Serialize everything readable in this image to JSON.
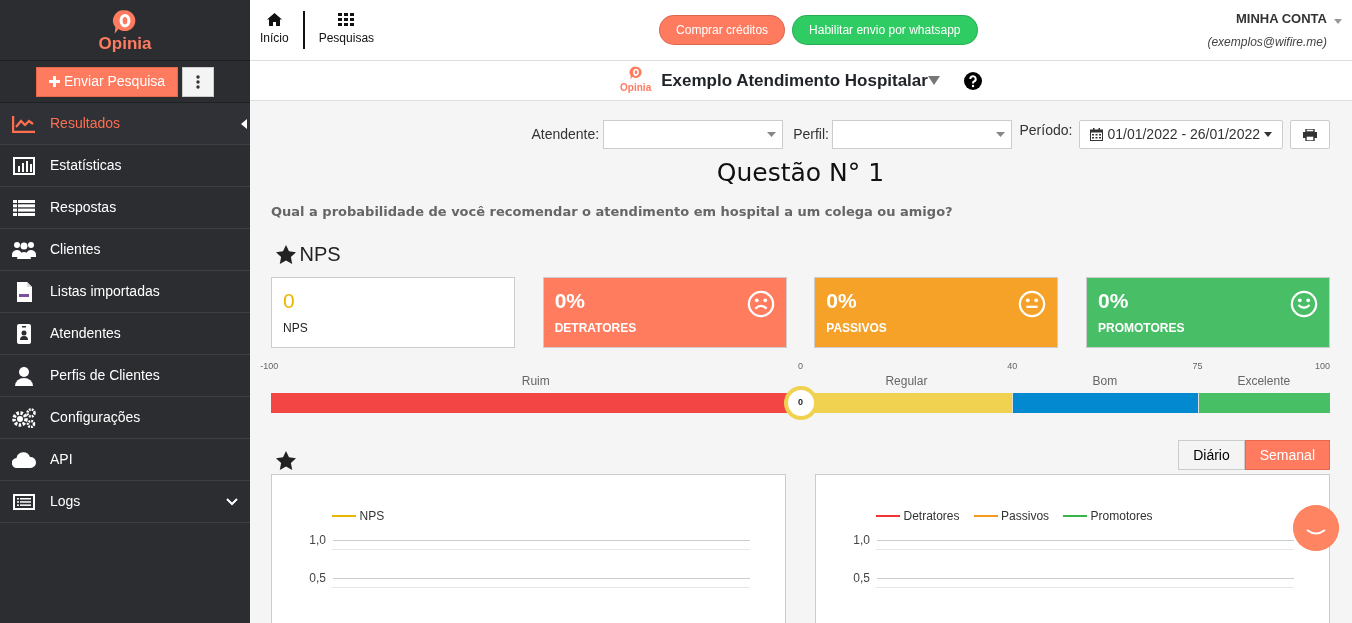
{
  "brand": {
    "name": "Opinia"
  },
  "sidebar": {
    "send_button": "Enviar Pesquisa",
    "items": [
      {
        "label": "Resultados",
        "selected": true
      },
      {
        "label": "Estatísticas",
        "selected": false
      },
      {
        "label": "Respostas",
        "selected": false
      },
      {
        "label": "Clientes",
        "selected": false
      },
      {
        "label": "Listas importadas",
        "selected": false
      },
      {
        "label": "Atendentes",
        "selected": false
      },
      {
        "label": "Perfis de Clientes",
        "selected": false
      },
      {
        "label": "Configurações",
        "selected": false
      },
      {
        "label": "API",
        "selected": false
      },
      {
        "label": "Logs",
        "selected": false
      }
    ]
  },
  "topnav": [
    {
      "label": "Início"
    },
    {
      "label": "Pesquisas"
    }
  ],
  "header_buttons": [
    {
      "label": "Comprar créditos",
      "color": "#ff7b5f"
    },
    {
      "label": "Habilitar envio por whatsapp",
      "color": "#2ecc63"
    }
  ],
  "account": {
    "title": "MINHA CONTA",
    "email": "(exemplos@wifire.me)"
  },
  "survey": {
    "brand": "Opinia",
    "title": "Exemplo Atendimento Hospitalar"
  },
  "filters": {
    "attendant_label": "Atendente:",
    "profile_label": "Perfil:",
    "period_label": "Período:",
    "period": "01/01/2022 - 26/01/2022"
  },
  "question": {
    "title": "Questão N° 1",
    "text": "Qual a probabilidade de você recomendar o atendimento em hospital a um colega ou amigo?"
  },
  "nps_title": "NPS",
  "cards": [
    {
      "kind": "score",
      "value": "0",
      "label": "NPS",
      "color": "#ffffff"
    },
    {
      "kind": "sad",
      "value": "0%",
      "label": "DETRATORES",
      "color": "#ff7d5e"
    },
    {
      "kind": "neutral",
      "value": "0%",
      "label": "PASSIVOS",
      "color": "#f6a228"
    },
    {
      "kind": "happy",
      "value": "0%",
      "label": "PROMOTORES",
      "color": "#48bf67"
    }
  ],
  "scale": {
    "ticks": [
      "-100",
      "0",
      "40",
      "75",
      "100"
    ],
    "segments": [
      {
        "label": "Ruim",
        "color": "#f44545"
      },
      {
        "label": "Regular",
        "color": "#f1d250"
      },
      {
        "label": "Bom",
        "color": "#0389cf"
      },
      {
        "label": "Excelente",
        "color": "#47bf64"
      }
    ],
    "marker": {
      "value": "0"
    }
  },
  "period_tabs": [
    {
      "label": "Diário",
      "selected": false
    },
    {
      "label": "Semanal",
      "selected": true
    }
  ],
  "charts": [
    {
      "legend": [
        {
          "name": "NPS",
          "color": "#e8b800"
        }
      ],
      "y_labels": [
        "1,0",
        "0,5"
      ]
    },
    {
      "legend": [
        {
          "name": "Detratores",
          "color": "#f03434"
        },
        {
          "name": "Passivos",
          "color": "#f79a1c"
        },
        {
          "name": "Promotores",
          "color": "#39b54a"
        }
      ],
      "y_labels": [
        "1,0",
        "0,5"
      ]
    }
  ]
}
